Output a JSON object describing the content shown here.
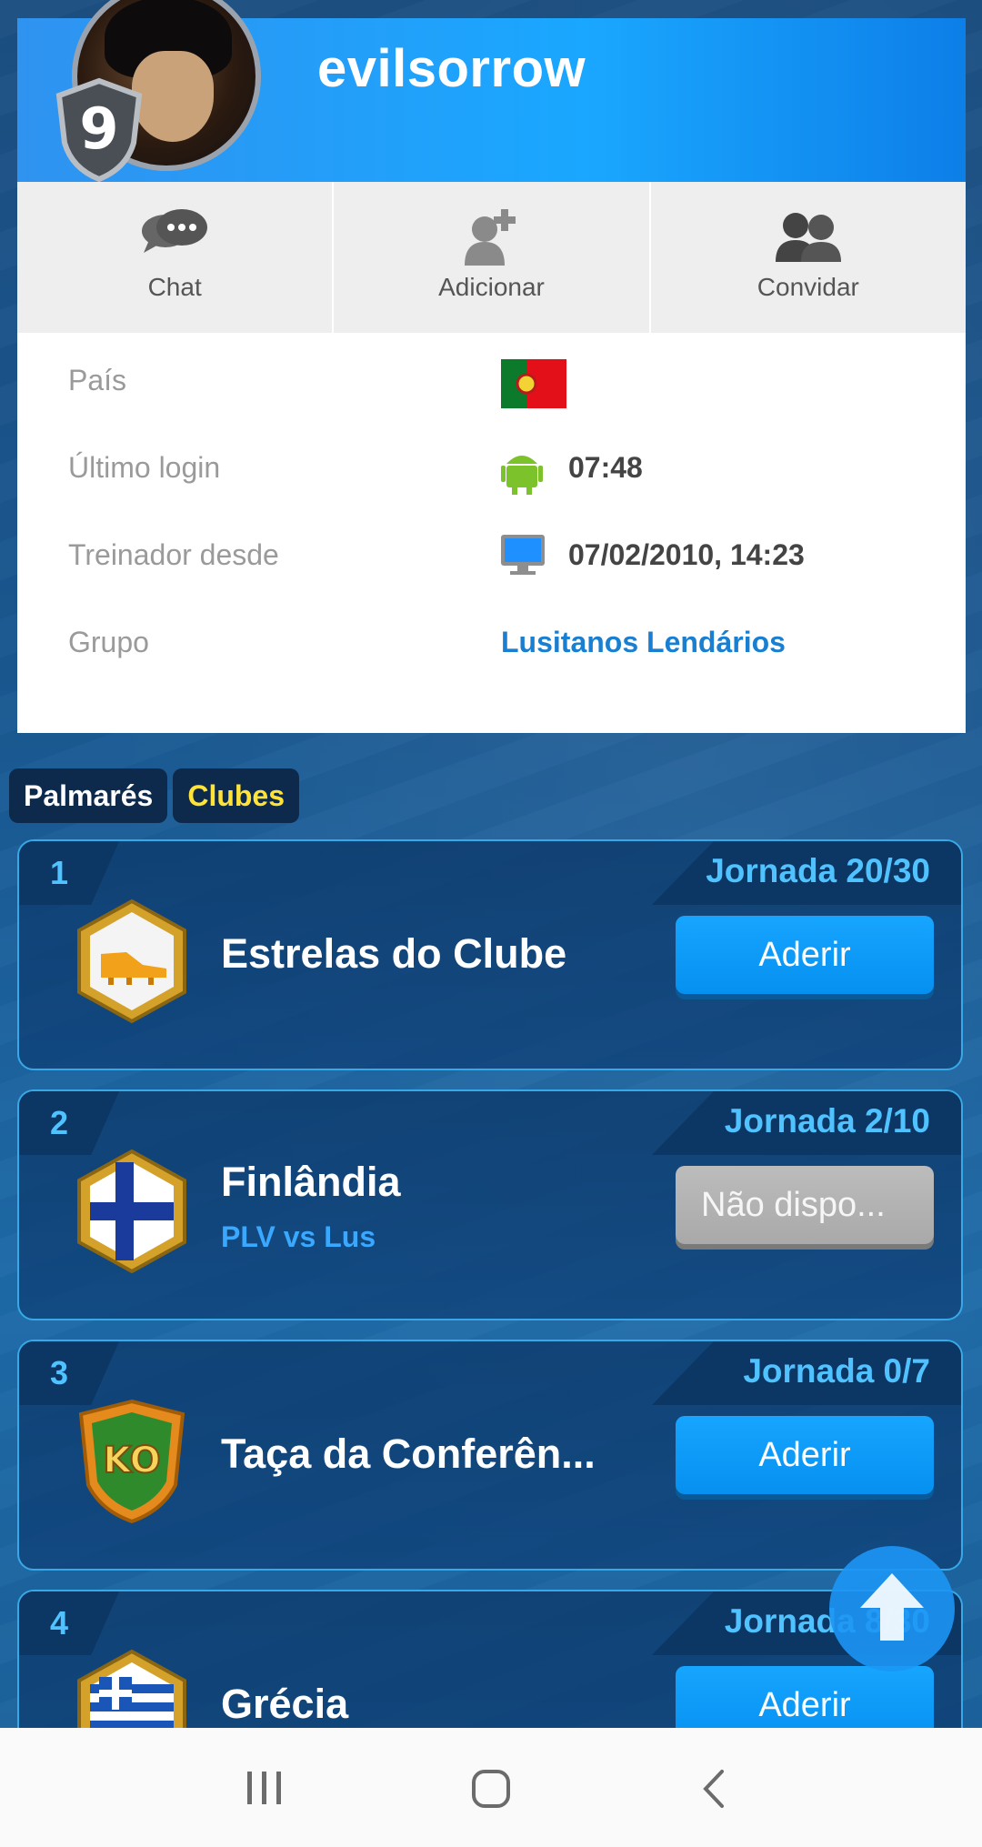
{
  "profile": {
    "username": "evilsorrow",
    "level": "9"
  },
  "actions": [
    {
      "label": "Chat",
      "icon": "chat-bubbles-icon"
    },
    {
      "label": "Adicionar",
      "icon": "add-friend-icon"
    },
    {
      "label": "Convidar",
      "icon": "invite-people-icon"
    }
  ],
  "info": {
    "country_label": "País",
    "country_flag": "portugal-flag",
    "last_login_label": "Último login",
    "last_login_value": "07:48",
    "last_login_icon": "android-icon",
    "coach_since_label": "Treinador desde",
    "coach_since_value": "07/02/2010, 14:23",
    "coach_since_icon": "desktop-icon",
    "group_label": "Grupo",
    "group_value": "Lusitanos Lendários"
  },
  "tabs": [
    {
      "label": "Palmarés",
      "active": false
    },
    {
      "label": "Clubes",
      "active": true
    }
  ],
  "competitions": [
    {
      "rank": "1",
      "round": "Jornada 20/30",
      "name": "Estrelas do Clube",
      "sub": "",
      "button": "Aderir",
      "emblem": "golden-boot-icon",
      "enabled": true
    },
    {
      "rank": "2",
      "round": "Jornada 2/10",
      "name": "Finlândia",
      "sub": "PLV vs Lus",
      "button": "Não dispo...",
      "emblem": "finland-flag-icon",
      "enabled": false
    },
    {
      "rank": "3",
      "round": "Jornada 0/7",
      "name": "Taça da Conferên...",
      "sub": "",
      "button": "Aderir",
      "emblem": "ko-cup-icon",
      "enabled": true
    },
    {
      "rank": "4",
      "round": "Jornada 8/30",
      "name": "Grécia",
      "sub": "",
      "button": "Aderir",
      "emblem": "greece-flag-icon",
      "enabled": true
    }
  ],
  "colors": {
    "accent": "#1aa7ff",
    "tab_active": "#ffe338",
    "round_text": "#4fc2ff",
    "link": "#1a7fd0"
  }
}
